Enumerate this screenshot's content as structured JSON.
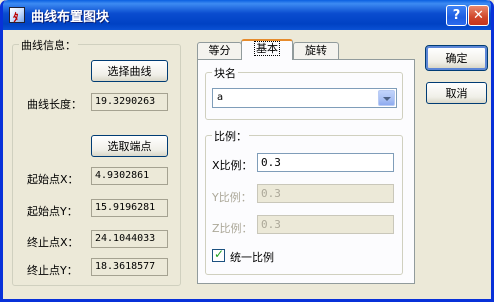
{
  "window": {
    "title": "曲线布置图块"
  },
  "curve_info": {
    "legend": "曲线信息：",
    "select_curve_button": "选择曲线",
    "curve_length_label": "曲线长度：",
    "curve_length_value": "19.3290263",
    "pick_endpoints_button": "选取端点",
    "start_x_label": "起始点X：",
    "start_x_value": "4.9302861",
    "start_y_label": "起始点Y：",
    "start_y_value": "15.9196281",
    "end_x_label": "终止点X：",
    "end_x_value": "24.1044033",
    "end_y_label": "终止点Y：",
    "end_y_value": "18.3618577"
  },
  "tabs": [
    {
      "label": "等分"
    },
    {
      "label": "基本"
    },
    {
      "label": "旋转"
    }
  ],
  "block_name": {
    "legend": "块名",
    "selected_value": "a"
  },
  "scale": {
    "legend": "比例：",
    "x_label": "X比例：",
    "x_value": "0.3",
    "y_label": "Y比例：",
    "y_value": "0.3",
    "z_label": "Z比例：",
    "z_value": "0.3",
    "uniform_checkbox_label": "统一比例",
    "uniform_checked": true
  },
  "actions": {
    "ok_button": "确定",
    "cancel_button": "取消"
  }
}
